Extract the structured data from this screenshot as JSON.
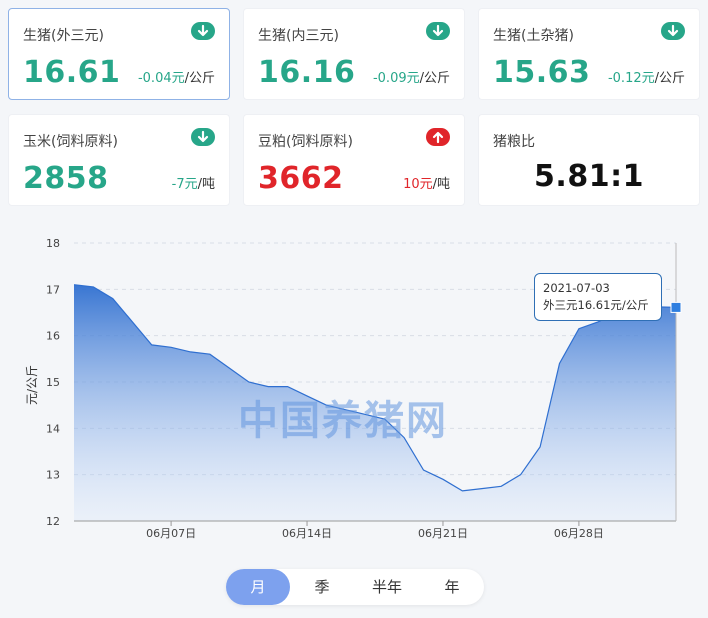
{
  "cards": [
    {
      "name": "生猪(外三元)",
      "price": "16.61",
      "change": "-0.04元",
      "unit": "/公斤",
      "trend": "down",
      "color": "#27a689"
    },
    {
      "name": "生猪(内三元)",
      "price": "16.16",
      "change": "-0.09元",
      "unit": "/公斤",
      "trend": "down",
      "color": "#27a689"
    },
    {
      "name": "生猪(土杂猪)",
      "price": "15.63",
      "change": "-0.12元",
      "unit": "/公斤",
      "trend": "down",
      "color": "#27a689"
    },
    {
      "name": "玉米(饲料原料)",
      "price": "2858",
      "change": "-7元",
      "unit": "/吨",
      "trend": "down",
      "color": "#27a689"
    },
    {
      "name": "豆粕(饲料原料)",
      "price": "3662",
      "change": "10元",
      "unit": "/吨",
      "trend": "up",
      "color": "#e0252a"
    },
    {
      "name": "猪粮比",
      "price": "5.81:1"
    }
  ],
  "icons": {
    "down": "arrow-down-circle-icon",
    "up": "arrow-up-circle-icon"
  },
  "watermark": "中国养猪网",
  "tooltip": {
    "date": "2021-07-03",
    "text": "外三元16.61元/公斤"
  },
  "period_tabs": [
    {
      "label": "月",
      "selected": true
    },
    {
      "label": "季",
      "selected": false
    },
    {
      "label": "半年",
      "selected": false
    },
    {
      "label": "年",
      "selected": false
    }
  ],
  "chart_data": {
    "type": "area",
    "ylabel": "元/公斤",
    "ylim": [
      12,
      18
    ],
    "yticks": [
      12,
      13,
      14,
      15,
      16,
      17,
      18
    ],
    "x_tick_labels": [
      "06月07日",
      "06月14日",
      "06月21日",
      "06月28日"
    ],
    "x_tick_index": [
      5,
      12,
      19,
      26
    ],
    "x": [
      "06-02",
      "06-03",
      "06-04",
      "06-05",
      "06-06",
      "06-07",
      "06-08",
      "06-09",
      "06-10",
      "06-11",
      "06-12",
      "06-13",
      "06-14",
      "06-15",
      "06-16",
      "06-17",
      "06-18",
      "06-19",
      "06-20",
      "06-21",
      "06-22",
      "06-23",
      "06-24",
      "06-25",
      "06-26",
      "06-27",
      "06-28",
      "06-29",
      "06-30",
      "07-01",
      "07-02",
      "07-03"
    ],
    "series": [
      {
        "values": [
          17.1,
          17.05,
          16.8,
          16.3,
          15.8,
          15.75,
          15.65,
          15.6,
          15.3,
          15.0,
          14.9,
          14.9,
          14.7,
          14.5,
          14.4,
          14.3,
          14.2,
          13.8,
          13.1,
          12.9,
          12.65,
          12.7,
          12.75,
          13.0,
          13.6,
          15.4,
          16.15,
          16.3,
          16.5,
          16.6,
          16.62,
          16.61
        ]
      }
    ],
    "grid": true,
    "color": "#2f6fd0"
  }
}
